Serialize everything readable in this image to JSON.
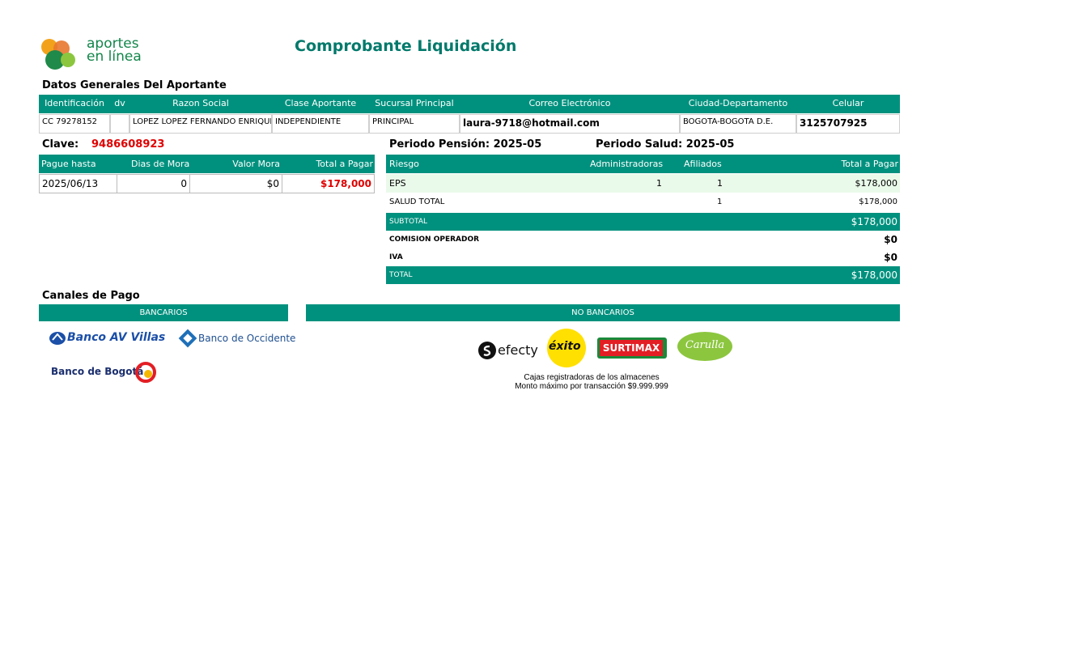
{
  "brand": {
    "line1": "aportes",
    "line2": "en línea"
  },
  "title": "Comprobante Liquidación",
  "general": {
    "heading": "Datos Generales Del Aportante",
    "headers": [
      "Identificación",
      "dv",
      "Razon Social",
      "Clase Aportante",
      "Sucursal Principal",
      "Correo Electrónico",
      "Ciudad-Departamento",
      "Celular"
    ],
    "values": [
      "CC 79278152",
      "",
      "LOPEZ LOPEZ FERNANDO ENRIQUE",
      "INDEPENDIENTE",
      "PRINCIPAL",
      "laura-9718@hotmail.com",
      "BOGOTA-BOGOTA D.E.",
      "3125707925"
    ]
  },
  "clave": {
    "label": "Clave:",
    "value": "9486608923"
  },
  "periods": {
    "pension": "Periodo Pensión: 2025-05",
    "salud": "Periodo Salud: 2025-05"
  },
  "payment": {
    "headers": [
      "Pague hasta",
      "Dias de Mora",
      "Valor Mora",
      "Total a Pagar"
    ],
    "values": [
      "2025/06/13",
      "0",
      "$0",
      "$178,000"
    ]
  },
  "risk": {
    "headers": [
      "Riesgo",
      "Administradoras",
      "Afiliados",
      "Total a Pagar"
    ],
    "rows": [
      {
        "riesgo": "EPS",
        "admin": "1",
        "afiliados": "1",
        "total": "$178,000"
      },
      {
        "riesgo": "SALUD TOTAL",
        "admin": "",
        "afiliados": "1",
        "total": "$178,000"
      }
    ],
    "subtotal_label": "SUBTOTAL",
    "subtotal": "$178,000",
    "comision_label": "COMISION OPERADOR",
    "comision": "$0",
    "iva_label": "IVA",
    "iva": "$0",
    "total_label": "TOTAL",
    "total": "$178,000"
  },
  "canales": {
    "heading": "Canales de Pago",
    "bancarios": "BANCARIOS",
    "no_bancarios": "NO BANCARIOS",
    "banks": [
      "Banco AV Villas",
      "Banco de Occidente",
      "Banco de Bogotá"
    ],
    "stores": [
      "efecty",
      "éxito",
      "SURTIMAX",
      "Carulla"
    ],
    "note1": "Cajas registradoras de los almacenes",
    "note2": "Monto máximo por transacción $9.999.999"
  },
  "colors": {
    "teal": "#00917e",
    "red": "#e00000",
    "light_row": "#eafaea"
  }
}
